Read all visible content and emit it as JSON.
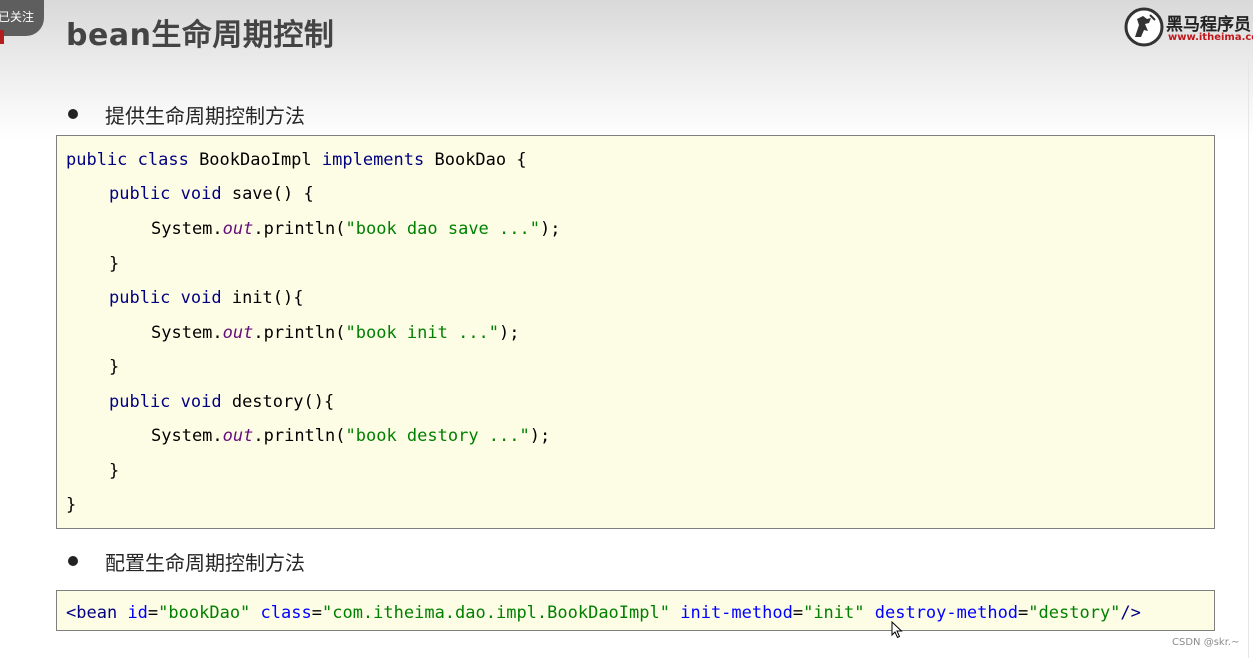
{
  "follow_label": "已关注",
  "title": "bean生命周期控制",
  "logo": {
    "name": "黑马程序员",
    "url": "www.itheima.com"
  },
  "bullets": [
    "提供生命周期控制方法",
    "配置生命周期控制方法"
  ],
  "code": {
    "line1": {
      "kw1": "public class",
      "t1": " BookDaoImpl ",
      "kw2": "implements",
      "t2": " BookDao {"
    },
    "line2": {
      "kw": "public void",
      "t": " save() {"
    },
    "line3": {
      "t1": "System.",
      "fld": "out",
      "t2": ".println(",
      "str": "\"book dao save ...\"",
      "t3": ");"
    },
    "line4": "}",
    "line5": {
      "kw": "public void",
      "t": " init(){"
    },
    "line6": {
      "t1": "System.",
      "fld": "out",
      "t2": ".println(",
      "str": "\"book init ...\"",
      "t3": ");"
    },
    "line7": "}",
    "line8": {
      "kw": "public void",
      "t": " destory(){"
    },
    "line9": {
      "t1": "System.",
      "fld": "out",
      "t2": ".println(",
      "str": "\"book destory ...\"",
      "t3": ");"
    },
    "line10": "}",
    "line11": "}"
  },
  "xml": {
    "open": "<bean",
    "a1": "id",
    "v1": "\"bookDao\"",
    "a2": "class",
    "v2": "\"com.itheima.dao.impl.BookDaoImpl\"",
    "a3": "init-method",
    "v3": "\"init\"",
    "a4": "destroy-method",
    "v4": "\"destory\"",
    "close": "/>"
  },
  "watermark": "CSDN @skr.~",
  "colors": {
    "code_bg": "#fdfde6",
    "keyword": "#000080",
    "string": "#008000",
    "field": "#660e7a",
    "xml_attr": "#0000ff"
  },
  "icons": [
    "itheima-horse-logo-icon",
    "mouse-cursor-icon"
  ]
}
